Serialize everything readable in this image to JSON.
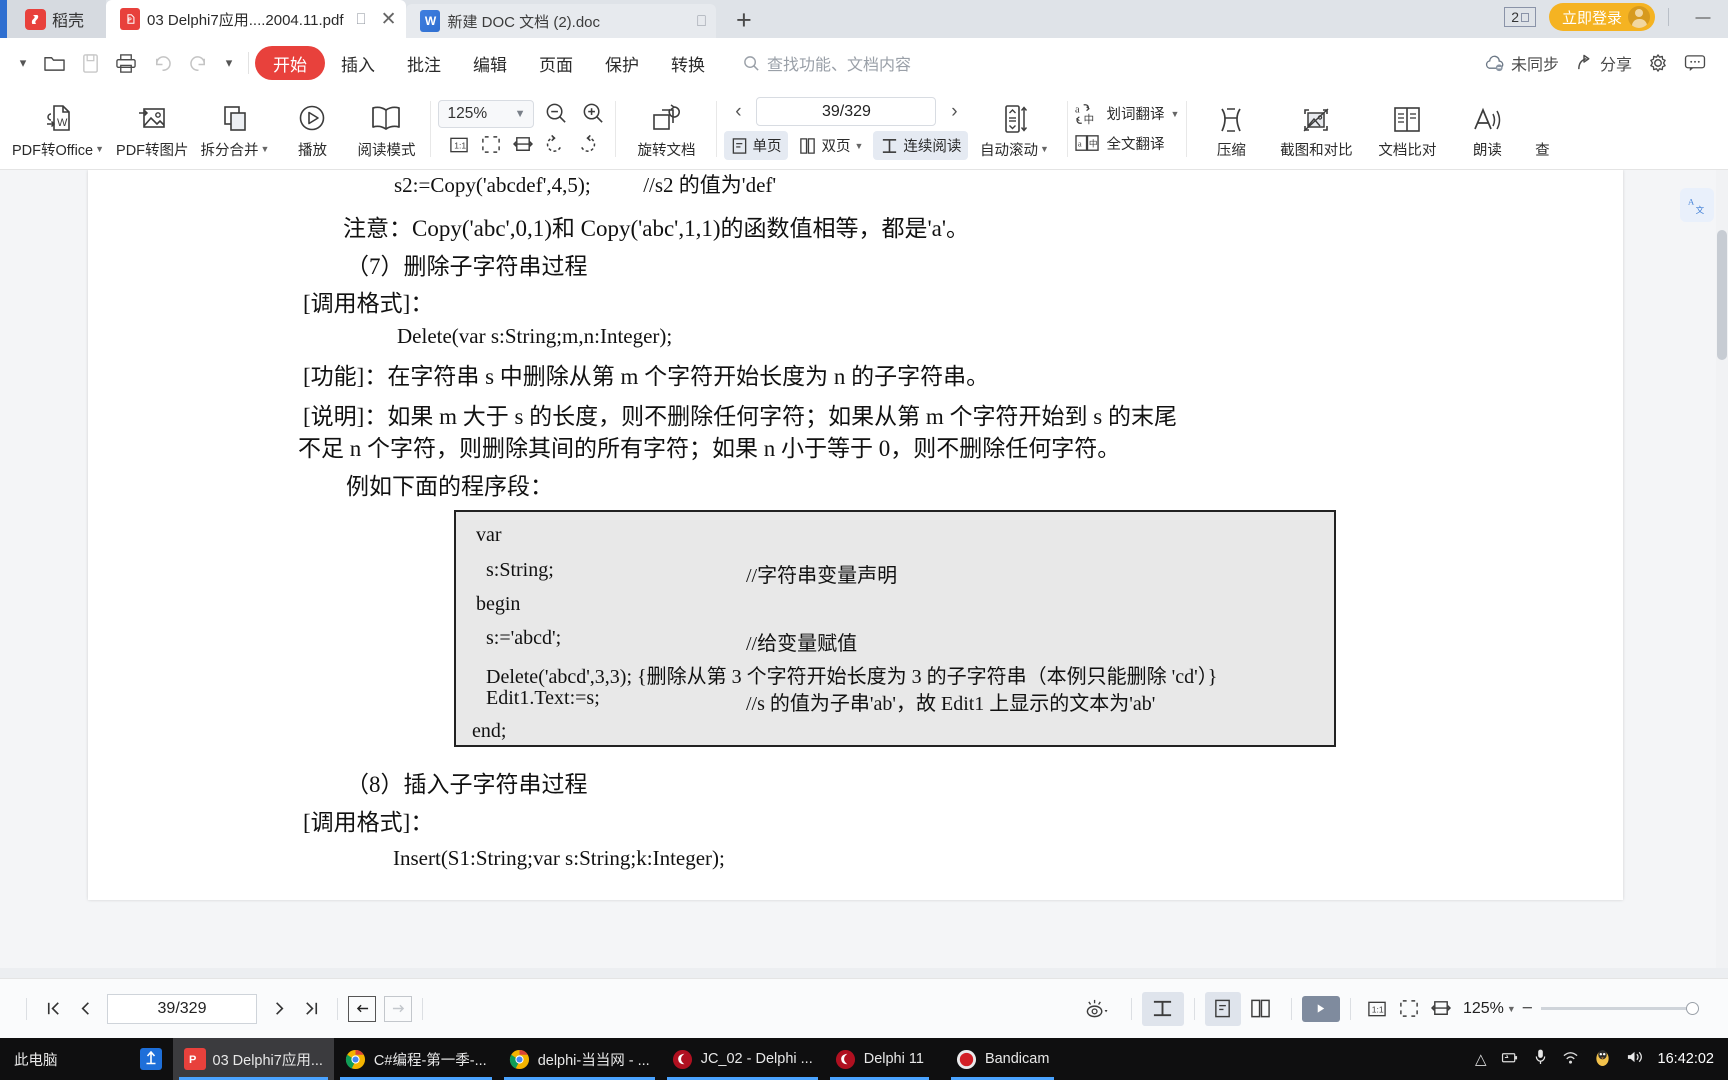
{
  "tabbar": {
    "home_tab_label": "稻壳",
    "home_tab_icon": "kdocs-logo-icon",
    "tabs": [
      {
        "label": "03 Delphi7应用....2004.11.pdf",
        "icon": "pdf-file-icon",
        "active": true,
        "restore_icon": "restore-icon",
        "close_icon": "close-icon"
      },
      {
        "label": "新建 DOC 文档 (2).doc",
        "icon": "doc-file-icon",
        "active": false,
        "restore_icon": "restore-icon"
      }
    ],
    "new_tab_label": "+",
    "window_count": "2",
    "login_label": "立即登录",
    "win_minimize": "—",
    "win_maximize": "▢",
    "win_close": "✕"
  },
  "menubar": {
    "quick_icons": [
      "chevron-down-icon",
      "open-folder-icon",
      "save-icon",
      "print-icon",
      "undo-icon",
      "redo-icon",
      "customize-icon"
    ],
    "items": [
      {
        "label": "开始",
        "active": true
      },
      {
        "label": "插入",
        "active": false
      },
      {
        "label": "批注",
        "active": false
      },
      {
        "label": "编辑",
        "active": false
      },
      {
        "label": "页面",
        "active": false
      },
      {
        "label": "保护",
        "active": false
      },
      {
        "label": "转换",
        "active": false
      }
    ],
    "search_placeholder": "查找功能、文档内容",
    "right": [
      {
        "label": "未同步",
        "icon": "cloud-sync-off-icon"
      },
      {
        "label": "分享",
        "icon": "share-icon"
      },
      {
        "label": "",
        "icon": "gear-icon"
      },
      {
        "label": "",
        "icon": "feedback-icon"
      }
    ]
  },
  "ribbon": {
    "buttons": [
      {
        "label": "PDF转Office",
        "icon": "pdf-to-office-icon",
        "caret": true
      },
      {
        "label": "PDF转图片",
        "icon": "pdf-to-image-icon",
        "caret": false
      },
      {
        "label": "拆分合并",
        "icon": "split-merge-icon",
        "caret": true
      },
      {
        "label": "播放",
        "icon": "play-circle-icon",
        "caret": false
      },
      {
        "label": "阅读模式",
        "icon": "book-open-icon",
        "caret": false
      }
    ],
    "zoom_value": "125%",
    "zoom_out_icon": "zoom-out-icon",
    "zoom_in_icon": "zoom-in-icon",
    "fit_icons": [
      "actual-size-icon",
      "fit-page-icon",
      "fit-width-icon",
      "rotate-left-icon",
      "rotate-right-icon"
    ],
    "rotate_doc_label": "旋转文档",
    "rotate_doc_icon": "rotate-document-icon",
    "page_value": "39/329",
    "prev_icon": "chevron-left-icon",
    "next_icon": "chevron-right-icon",
    "view_modes": [
      {
        "label": "单页",
        "icon": "single-page-icon",
        "selected": true,
        "caret": false
      },
      {
        "label": "双页",
        "icon": "double-page-icon",
        "selected": false,
        "caret": true
      },
      {
        "label": "连续阅读",
        "icon": "continuous-read-icon",
        "selected": true,
        "caret": false
      }
    ],
    "auto_scroll_label": "自动滚动",
    "auto_scroll_icon": "auto-scroll-icon",
    "translate_word_label": "划词翻译",
    "translate_word_icon": "translate-word-icon",
    "translate_full_label": "全文翻译",
    "translate_full_icon": "translate-full-icon",
    "tail_buttons": [
      {
        "label": "压缩",
        "icon": "compress-icon"
      },
      {
        "label": "截图和对比",
        "icon": "screenshot-compare-icon"
      },
      {
        "label": "文档比对",
        "icon": "document-compare-icon"
      },
      {
        "label": "朗读",
        "icon": "read-aloud-icon"
      },
      {
        "label": "查",
        "icon": "search-doc-icon"
      }
    ]
  },
  "document": {
    "lines": [
      "s2:=Copy('abcdef',4,5);          //s2 的值为'def'",
      "注意：Copy('abc',0,1)和 Copy('abc',1,1)的函数值相等，都是'a'。",
      "（7）删除子字符串过程",
      "[调用格式]：",
      "Delete(var s:String;m,n:Integer);",
      "[功能]：在字符串 s 中删除从第 m 个字符开始长度为 n 的子字符串。",
      "[说明]：如果 m 大于 s 的长度，则不删除任何字符；如果从第 m 个字符开始到 s 的末尾",
      "不足 n 个字符，则删除其间的所有字符；如果 n 小于等于 0，则不删除任何字符。",
      "例如下面的程序段：",
      "（8）插入子字符串过程",
      "[调用格式]：",
      "Insert(S1:String;var s:String;k:Integer);"
    ],
    "code_block": [
      "var",
      "  s:String;",
      "//字符串变量声明",
      "begin",
      "  s:='abcd';",
      "//给变量赋值",
      "  Delete('abcd',3,3); {删除从第 3 个字符开始长度为 3 的子字符串（本例只能删除 'cd'）}",
      "  Edit1.Text:=s;",
      "//s 的值为子串'ab'，故 Edit1 上显示的文本为'ab'",
      "end;"
    ],
    "float_icon": "translate-panel-icon"
  },
  "statusbar": {
    "first_page_icon": "first-page-icon",
    "prev_page_icon": "prev-page-icon",
    "page_value": "39/329",
    "next_page_icon": "next-page-icon",
    "last_page_icon": "last-page-icon",
    "back_icon": "back-arrow-icon",
    "forward_icon": "forward-arrow-icon",
    "eye_icon": "eye-protect-icon",
    "continuous_icon": "continuous-read-icon",
    "single_page_icon": "single-page-icon",
    "double_page_icon": "double-page-icon",
    "play_icon": "play-icon",
    "actual_size_icon": "actual-size-icon",
    "fit_page_icon": "fit-page-icon",
    "fit_width_icon": "fit-width-icon",
    "zoom_value": "125%",
    "zoom_minus": "−",
    "zoom_plus": "+"
  },
  "taskbar": {
    "items": [
      {
        "label": "此电脑",
        "icon": "this-pc-icon",
        "icon_color": "#1a1a1a",
        "glyph": "",
        "active": false,
        "running": false
      },
      {
        "label": "",
        "icon": "tim-icon",
        "icon_color": "#1e6fd9",
        "glyph": "⚓",
        "active": false,
        "running": false
      },
      {
        "label": "03 Delphi7应用...",
        "icon": "wps-pdf-icon",
        "icon_color": "#e8413c",
        "glyph": "P",
        "active": true,
        "running": true
      },
      {
        "label": "C#编程-第一季-...",
        "icon": "chrome-icon",
        "icon_color": "#ffffff",
        "glyph": "",
        "active": false,
        "running": true
      },
      {
        "label": "delphi-当当网 - ...",
        "icon": "chrome-icon",
        "icon_color": "#ffffff",
        "glyph": "",
        "active": false,
        "running": true
      },
      {
        "label": "JC_02 - Delphi ...",
        "icon": "delphi-icon",
        "icon_color": "#b01020",
        "glyph": "",
        "active": false,
        "running": true
      },
      {
        "label": "Delphi 11",
        "icon": "delphi-icon",
        "icon_color": "#b01020",
        "glyph": "",
        "active": false,
        "running": true
      },
      {
        "label": "Bandicam",
        "icon": "bandicam-icon",
        "icon_color": "#d21f26",
        "glyph": "",
        "active": false,
        "running": true
      }
    ],
    "tray_icons": [
      "show-hidden-icons-icon",
      "battery-icon",
      "microphone-icon",
      "network-icon",
      "qq-penguin-icon",
      "volume-icon"
    ],
    "clock": "16:42:02"
  }
}
